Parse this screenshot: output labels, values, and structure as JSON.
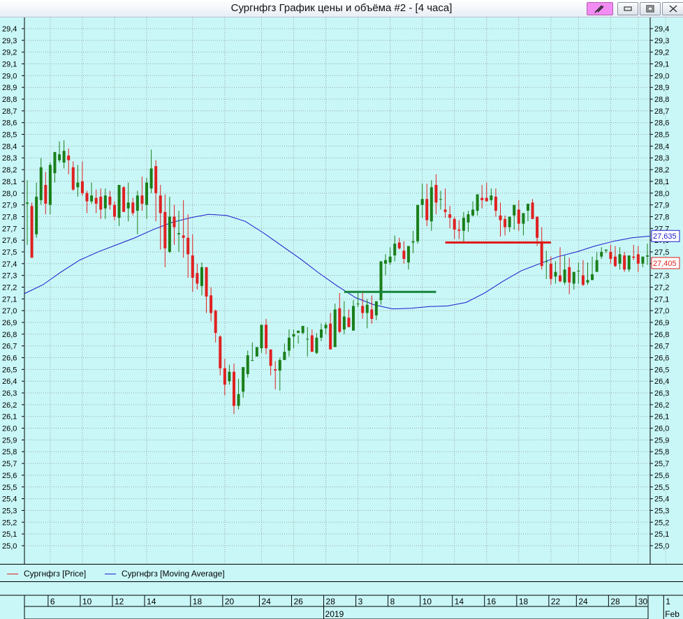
{
  "window": {
    "title": "Сургнфгз График цены и объёма #2 - [4 часа]",
    "buttons": [
      "pin",
      "minimize",
      "maximize",
      "close"
    ]
  },
  "colors": {
    "background": "#c9f7f7",
    "up_candle": "#1a7f1a",
    "down_candle": "#e02020",
    "moving_average": "#1a1acc",
    "support_line": "#16843c",
    "resistance_line": "#e01818",
    "grid": "#9aa6a6"
  },
  "legend": [
    {
      "label": "Сургнфгз [Price]",
      "color": "#e02020"
    },
    {
      "label": "Сургнфгз [Moving Average]",
      "color": "#1a1acc"
    }
  ],
  "chart_data": {
    "type": "candlestick",
    "ylim": [
      24.9,
      29.45
    ],
    "y_ticks": [
      "29,4",
      "29,3",
      "29,2",
      "29,1",
      "29,0",
      "28,9",
      "28,8",
      "28,7",
      "28,6",
      "28,5",
      "28,4",
      "28,3",
      "28,2",
      "28,1",
      "28,0",
      "27,9",
      "27,8",
      "27,7",
      "27,6",
      "27,5",
      "27,4",
      "27,3",
      "27,2",
      "27,1",
      "27,0",
      "26,9",
      "26,8",
      "26,7",
      "26,6",
      "26,5",
      "26,4",
      "26,3",
      "26,2",
      "26,1",
      "26,0",
      "25,9",
      "25,8",
      "25,7",
      "25,6",
      "25,5",
      "25,4",
      "25,3",
      "25,2",
      "25,1",
      "25,0"
    ],
    "x_tick_labels": [
      "6",
      "10",
      "12",
      "14",
      "18",
      "20",
      "24",
      "26",
      "28",
      "3",
      "8",
      "10",
      "14",
      "16",
      "18",
      "22",
      "24",
      "28",
      "30",
      "1"
    ],
    "period_labels": [
      "2019",
      "Feb"
    ],
    "price_label": "27,405",
    "ma_label": "27,635",
    "candles": [
      [
        27.91,
        28.11,
        27.92,
        27.56
      ],
      [
        27.89,
        27.92,
        27.45,
        27.65
      ],
      [
        27.65,
        28.09,
        27.97,
        27.62
      ],
      [
        27.94,
        28.3,
        28.22,
        27.9
      ],
      [
        28.07,
        28.18,
        27.91,
        27.82
      ],
      [
        27.9,
        28.26,
        28.24,
        27.82
      ],
      [
        28.17,
        28.34,
        28.35,
        28.09
      ],
      [
        28.28,
        28.44,
        28.33,
        28.26
      ],
      [
        28.26,
        28.45,
        28.36,
        28.21
      ],
      [
        28.32,
        28.38,
        28.28,
        28.16
      ],
      [
        28.22,
        28.27,
        28.03,
        28.02
      ],
      [
        28.05,
        28.24,
        28.09,
        27.97
      ],
      [
        28.1,
        28.27,
        28.0,
        27.98
      ],
      [
        28.0,
        28.02,
        27.93,
        27.83
      ],
      [
        27.93,
        28.09,
        27.98,
        27.91
      ],
      [
        27.96,
        28.03,
        27.91,
        27.83
      ],
      [
        27.97,
        28.04,
        27.86,
        27.78
      ],
      [
        27.87,
        28.04,
        27.98,
        27.78
      ],
      [
        27.97,
        28.02,
        27.9,
        27.86
      ],
      [
        27.9,
        27.93,
        27.8,
        27.77
      ],
      [
        27.79,
        28.03,
        28.07,
        27.72
      ],
      [
        28.05,
        28.06,
        27.84,
        27.85
      ],
      [
        27.87,
        28.09,
        27.92,
        27.76
      ],
      [
        27.92,
        27.96,
        27.83,
        27.81
      ],
      [
        27.85,
        28.02,
        27.98,
        27.65
      ],
      [
        27.98,
        28.14,
        27.91,
        27.85
      ],
      [
        27.9,
        28.13,
        28.09,
        27.78
      ],
      [
        28.04,
        28.37,
        28.21,
        28.0
      ],
      [
        28.23,
        28.28,
        28.0,
        27.76
      ],
      [
        27.98,
        28.07,
        27.83,
        27.52
      ],
      [
        27.84,
        27.99,
        27.53,
        27.37
      ],
      [
        27.5,
        27.97,
        27.8,
        27.49
      ],
      [
        27.8,
        27.9,
        27.71,
        27.56
      ],
      [
        27.65,
        27.85,
        27.66,
        27.5
      ],
      [
        27.64,
        27.94,
        27.62,
        27.45
      ],
      [
        27.62,
        27.82,
        27.48,
        27.28
      ],
      [
        27.47,
        27.65,
        27.28,
        27.16
      ],
      [
        27.32,
        27.4,
        27.23,
        27.18
      ],
      [
        27.21,
        27.41,
        27.37,
        27.13
      ],
      [
        27.37,
        27.36,
        27.12,
        26.98
      ],
      [
        27.13,
        27.2,
        26.98,
        26.91
      ],
      [
        27.0,
        27.01,
        26.81,
        26.73
      ],
      [
        26.78,
        26.79,
        26.51,
        26.45
      ],
      [
        26.51,
        26.59,
        26.37,
        26.28
      ],
      [
        26.4,
        26.54,
        26.48,
        26.37
      ],
      [
        26.48,
        26.55,
        26.19,
        26.12
      ],
      [
        26.19,
        26.42,
        26.29,
        26.16
      ],
      [
        26.31,
        26.5,
        26.52,
        26.26
      ],
      [
        26.46,
        26.66,
        26.62,
        26.43
      ],
      [
        26.58,
        26.73,
        26.58,
        26.57
      ],
      [
        26.61,
        26.69,
        26.69,
        26.61
      ],
      [
        26.68,
        26.83,
        26.88,
        26.64
      ],
      [
        26.88,
        26.93,
        26.68,
        26.63
      ],
      [
        26.67,
        26.65,
        26.53,
        26.45
      ],
      [
        26.5,
        26.57,
        26.49,
        26.33
      ],
      [
        26.49,
        26.6,
        26.58,
        26.32
      ],
      [
        26.58,
        26.72,
        26.65,
        26.58
      ],
      [
        26.66,
        26.84,
        26.77,
        26.61
      ],
      [
        26.78,
        26.84,
        26.8,
        26.68
      ],
      [
        26.81,
        26.79,
        26.83,
        26.72
      ],
      [
        26.81,
        26.87,
        26.87,
        26.8
      ],
      [
        26.76,
        26.86,
        26.76,
        26.61
      ],
      [
        26.79,
        26.84,
        26.65,
        26.65
      ],
      [
        26.64,
        26.81,
        26.77,
        26.63
      ],
      [
        26.77,
        26.89,
        26.84,
        26.74
      ],
      [
        26.85,
        26.9,
        26.88,
        26.8
      ],
      [
        26.89,
        26.98,
        26.67,
        26.74
      ],
      [
        26.69,
        27.06,
        27.01,
        26.73
      ],
      [
        27.02,
        27.15,
        26.82,
        26.81
      ],
      [
        26.84,
        27.08,
        26.95,
        26.8
      ],
      [
        26.94,
        27.01,
        26.86,
        26.86
      ],
      [
        26.83,
        27.09,
        27.04,
        26.88
      ],
      [
        27.06,
        27.16,
        27.06,
        27.03
      ],
      [
        27.04,
        27.15,
        26.98,
        26.93
      ],
      [
        26.98,
        27.1,
        27.05,
        26.85
      ],
      [
        27.01,
        27.13,
        26.93,
        26.89
      ],
      [
        26.96,
        27.07,
        27.08,
        26.92
      ],
      [
        27.09,
        27.17,
        27.42,
        27.05
      ],
      [
        27.4,
        27.48,
        27.43,
        27.3
      ],
      [
        27.41,
        27.54,
        27.46,
        27.39
      ],
      [
        27.47,
        27.64,
        27.57,
        27.42
      ],
      [
        27.58,
        27.62,
        27.53,
        27.52
      ],
      [
        27.51,
        27.59,
        27.44,
        27.4
      ],
      [
        27.41,
        27.44,
        27.55,
        27.35
      ],
      [
        27.58,
        27.68,
        27.59,
        27.49
      ],
      [
        27.59,
        27.69,
        27.9,
        27.57
      ],
      [
        27.9,
        28.08,
        27.95,
        27.79
      ],
      [
        27.95,
        28.08,
        27.77,
        27.72
      ],
      [
        27.76,
        28.11,
        28.05,
        27.68
      ],
      [
        28.07,
        28.16,
        27.92,
        27.82
      ],
      [
        27.95,
        28.02,
        27.95,
        27.86
      ],
      [
        27.86,
        28.04,
        27.84,
        27.79
      ],
      [
        27.82,
        27.89,
        27.79,
        27.7
      ],
      [
        27.78,
        27.8,
        27.69,
        27.61
      ],
      [
        27.69,
        27.77,
        27.68,
        27.61
      ],
      [
        27.68,
        27.84,
        27.79,
        27.57
      ],
      [
        27.75,
        27.85,
        27.82,
        27.67
      ],
      [
        27.81,
        27.93,
        27.86,
        27.8
      ],
      [
        27.85,
        27.94,
        27.99,
        27.81
      ],
      [
        27.96,
        28.07,
        27.94,
        27.87
      ],
      [
        27.96,
        28.09,
        27.93,
        27.94
      ],
      [
        27.94,
        28.04,
        27.98,
        27.9
      ],
      [
        27.97,
        28.04,
        27.85,
        27.8
      ],
      [
        27.81,
        27.92,
        27.77,
        27.63
      ],
      [
        27.78,
        27.81,
        27.71,
        27.64
      ],
      [
        27.71,
        27.78,
        27.8,
        27.67
      ],
      [
        27.81,
        27.85,
        27.9,
        27.69
      ],
      [
        27.86,
        27.94,
        27.74,
        27.68
      ],
      [
        27.74,
        27.83,
        27.83,
        27.64
      ],
      [
        27.85,
        27.91,
        27.91,
        27.76
      ],
      [
        27.92,
        27.95,
        27.78,
        27.83
      ],
      [
        27.8,
        27.74,
        27.62,
        27.55
      ],
      [
        27.59,
        27.71,
        27.38,
        27.35
      ],
      [
        27.42,
        27.51,
        27.42,
        27.27
      ],
      [
        27.4,
        27.46,
        27.27,
        27.22
      ],
      [
        27.29,
        27.42,
        27.33,
        27.23
      ],
      [
        27.3,
        27.54,
        27.25,
        27.24
      ],
      [
        27.24,
        27.47,
        27.35,
        27.22
      ],
      [
        27.37,
        27.45,
        27.24,
        27.14
      ],
      [
        27.23,
        27.32,
        27.33,
        27.18
      ],
      [
        27.34,
        27.41,
        27.34,
        27.23
      ],
      [
        27.3,
        27.43,
        27.22,
        27.21
      ],
      [
        27.24,
        27.41,
        27.26,
        27.22
      ],
      [
        27.26,
        27.46,
        27.31,
        27.26
      ],
      [
        27.33,
        27.5,
        27.43,
        27.33
      ],
      [
        27.46,
        27.54,
        27.5,
        27.44
      ],
      [
        27.51,
        27.51,
        27.52,
        27.49
      ],
      [
        27.5,
        27.56,
        27.44,
        27.4
      ],
      [
        27.46,
        27.55,
        27.38,
        27.37
      ],
      [
        27.4,
        27.54,
        27.48,
        27.35
      ],
      [
        27.47,
        27.5,
        27.35,
        27.33
      ],
      [
        27.35,
        27.41,
        27.47,
        27.33
      ],
      [
        27.46,
        27.56,
        27.45,
        27.43
      ],
      [
        27.48,
        27.55,
        27.4,
        27.33
      ],
      [
        27.4,
        27.46,
        27.46,
        27.37
      ],
      [
        27.46,
        27.57,
        27.47,
        27.39
      ]
    ],
    "moving_average": [
      [
        0,
        27.145
      ],
      [
        10,
        27.22
      ],
      [
        20,
        27.33
      ],
      [
        30,
        27.43
      ],
      [
        40,
        27.5
      ],
      [
        50,
        27.56
      ],
      [
        60,
        27.62
      ],
      [
        70,
        27.69
      ],
      [
        80,
        27.75
      ],
      [
        90,
        27.79
      ],
      [
        100,
        27.82
      ],
      [
        110,
        27.81
      ],
      [
        120,
        27.76
      ],
      [
        130,
        27.66
      ],
      [
        140,
        27.55
      ],
      [
        150,
        27.44
      ],
      [
        160,
        27.32
      ],
      [
        170,
        27.21
      ],
      [
        180,
        27.11
      ],
      [
        190,
        27.05
      ],
      [
        200,
        27.015
      ],
      [
        210,
        27.02
      ],
      [
        220,
        27.035
      ],
      [
        230,
        27.04
      ],
      [
        240,
        27.07
      ],
      [
        250,
        27.15
      ],
      [
        260,
        27.25
      ],
      [
        270,
        27.34
      ],
      [
        280,
        27.4
      ],
      [
        290,
        27.46
      ],
      [
        300,
        27.5
      ],
      [
        310,
        27.55
      ],
      [
        320,
        27.59
      ],
      [
        330,
        27.62
      ],
      [
        340,
        27.635
      ]
    ],
    "support_line": {
      "x": [
        69,
        89
      ],
      "y": 27.16
    },
    "resistance_line": {
      "x": [
        91,
        114
      ],
      "y": 27.58
    }
  }
}
